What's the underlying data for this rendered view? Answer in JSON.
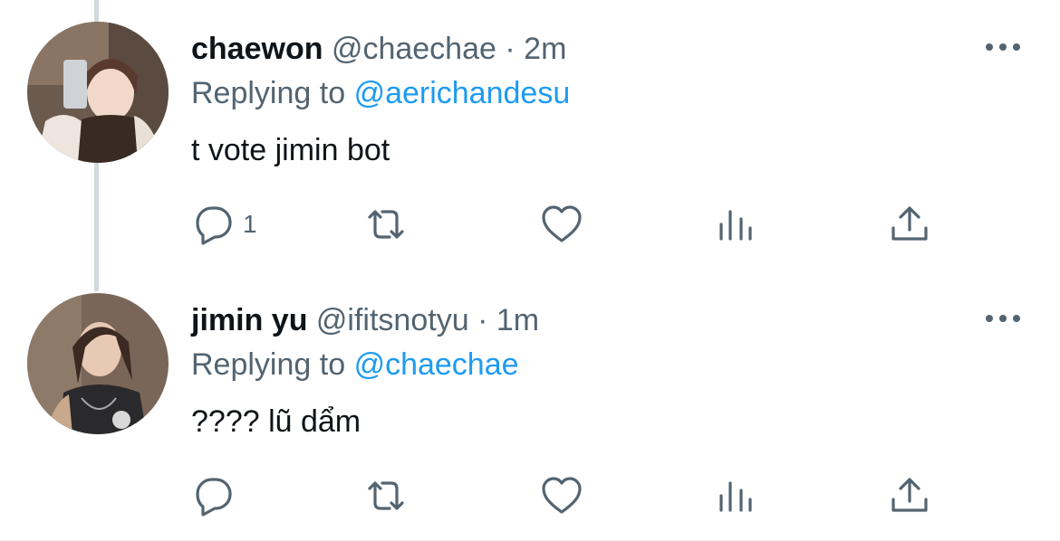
{
  "theme": {
    "text": "#0f1419",
    "secondary": "#536471",
    "accent": "#1d9bf0",
    "thread_line": "#cfd9de"
  },
  "tweets": [
    {
      "display_name": "chaewon",
      "handle": "@chaechae",
      "separator": "·",
      "time": "2m",
      "replying_prefix": "Replying to",
      "replying_to": "@aerichandesu",
      "text": "t vote jimin bot",
      "reply_count": "1",
      "icons": {
        "reply": "comment-icon",
        "retweet": "retweet-icon",
        "like": "heart-icon",
        "views": "analytics-icon",
        "share": "share-icon",
        "more": "more-icon"
      }
    },
    {
      "display_name": "jimin yu",
      "handle": "@ifitsnotyu",
      "separator": "·",
      "time": "1m",
      "replying_prefix": "Replying to",
      "replying_to": "@chaechae",
      "text": "???? lũ dẩm",
      "reply_count": "",
      "icons": {
        "reply": "comment-icon",
        "retweet": "retweet-icon",
        "like": "heart-icon",
        "views": "analytics-icon",
        "share": "share-icon",
        "more": "more-icon"
      }
    }
  ]
}
